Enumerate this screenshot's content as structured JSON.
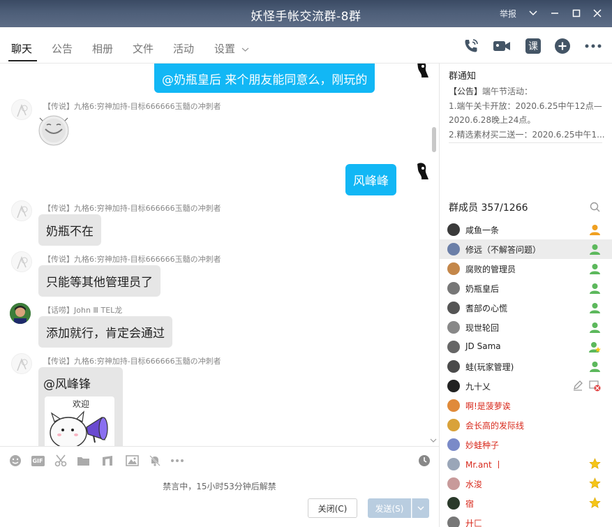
{
  "window": {
    "title": "妖怪手帐交流群-8群",
    "report_label": "举报"
  },
  "tabs": [
    "聊天",
    "公告",
    "相册",
    "文件",
    "活动",
    "设置"
  ],
  "messages": [
    {
      "from": "me",
      "text": "@奶瓶皇后  来个朋友能同意么，刚玩的"
    },
    {
      "from": "other",
      "tag": "【传说】",
      "sender": "九格6:穷神加持-目标666666玉髓の冲刺者",
      "type": "sticker"
    },
    {
      "from": "me",
      "text": "风峰峰"
    },
    {
      "from": "other",
      "tag": "【传说】",
      "sender": "九格6:穷神加持-目标666666玉髓の冲刺者",
      "text": "奶瓶不在"
    },
    {
      "from": "other",
      "tag": "【传说】",
      "sender": "九格6:穷神加持-目标666666玉髓の冲刺者",
      "text": "只能等其他管理员了"
    },
    {
      "from": "other",
      "tag": "【话唠】",
      "sender": "John Ⅲ TEL龙",
      "text": "添加就行，肯定会通过"
    },
    {
      "from": "other",
      "tag": "【传说】",
      "sender": "九格6:穷神加持-目标666666玉髓の冲刺者",
      "text": "@风峰锋",
      "sticker_caption": "欢迎"
    }
  ],
  "notice": {
    "title": "群通知",
    "tag": "【公告】",
    "lines": [
      "端午节活动：",
      "1.端午关卡开放：2020.6.25中午12点—",
      "2020.6.28晚上24点。",
      "2.精选素材买二送一：2020.6.25中午1..."
    ]
  },
  "members": {
    "title": "群成员 357/1266",
    "list": [
      {
        "name": "咸鱼一条",
        "red": false,
        "badge": "owner",
        "selected": false
      },
      {
        "name": "修远（不解答问题）",
        "red": false,
        "badge": "admin",
        "selected": true
      },
      {
        "name": "腐败的管理员",
        "red": false,
        "badge": "admin",
        "selected": false
      },
      {
        "name": "奶瓶皇后",
        "red": false,
        "badge": "admin",
        "selected": false
      },
      {
        "name": "耆部の心慌",
        "red": false,
        "badge": "admin",
        "selected": false
      },
      {
        "name": "现世轮回",
        "red": false,
        "badge": "admin",
        "selected": false
      },
      {
        "name": "JD Sama",
        "red": false,
        "badge": "admin-star",
        "selected": false
      },
      {
        "name": "蛙(玩家管理)",
        "red": false,
        "badge": "admin",
        "selected": false
      },
      {
        "name": "九十乂",
        "red": false,
        "badge": "edit",
        "selected": false
      },
      {
        "name": "啊!是菠萝诶",
        "red": true,
        "badge": "",
        "selected": false
      },
      {
        "name": "会长高的发际线",
        "red": true,
        "badge": "",
        "selected": false
      },
      {
        "name": "妙蛙种子",
        "red": true,
        "badge": "",
        "selected": false
      },
      {
        "name": "Mr.ant 丨",
        "red": true,
        "badge": "star",
        "selected": false
      },
      {
        "name": "水浚",
        "red": true,
        "badge": "star",
        "selected": false
      },
      {
        "name": "宿",
        "red": true,
        "badge": "star",
        "selected": false
      },
      {
        "name": "廾匚",
        "red": true,
        "badge": "",
        "selected": false
      }
    ]
  },
  "compose": {
    "mute_text": "禁言中，15小时53分钟后解禁",
    "close_label": "关闭(C)",
    "send_label": "发送(S)"
  },
  "colors": {
    "my_bubble": "#12b7f5",
    "other_bubble": "#e6e6e6",
    "member_red": "#d8291c"
  }
}
